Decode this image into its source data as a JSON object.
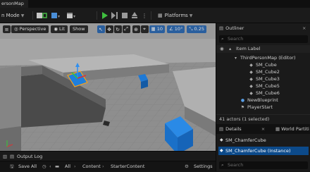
{
  "window": {
    "tab_title": "ersonMap"
  },
  "toolbar": {
    "mode": "n Mode",
    "platforms": "Platforms"
  },
  "viewport": {
    "perspective": "Perspective",
    "lit": "Lit",
    "show": "Show",
    "grid_snap": "10",
    "rot_snap": "10°",
    "scale_snap": "0.25",
    "colors": {
      "selection": "#f0a020",
      "accent_cube": "#1a7bd8"
    }
  },
  "outliner": {
    "title": "Outliner",
    "search_placeholder": "Search",
    "column_label": "Item Label",
    "items": [
      {
        "label": "ThirdPersonMap (Editor)",
        "icon": "level-icon"
      },
      {
        "label": "SM_Cube",
        "icon": "mesh-icon"
      },
      {
        "label": "SM_Cube2",
        "icon": "mesh-icon"
      },
      {
        "label": "SM_Cube3",
        "icon": "mesh-icon"
      },
      {
        "label": "SM_Cube5",
        "icon": "mesh-icon"
      },
      {
        "label": "SM_Cube6",
        "icon": "mesh-icon"
      },
      {
        "label": "NewBlueprint",
        "icon": "blueprint-icon"
      },
      {
        "label": "PlayerStart",
        "icon": "player-start-icon"
      }
    ],
    "footer": "41 actors (1 selected)"
  },
  "details": {
    "tab_details": "Details",
    "tab_world": "World Partiti",
    "actor_name": "SM_ChamferCube",
    "instance": "SM_ChamferCube (Instance)",
    "search_placeholder": "Search"
  },
  "bottom": {
    "output_log": "Output Log",
    "save_all": "Save All",
    "all": "All",
    "content": "Content",
    "starter_content": "StarterContent",
    "settings": "Settings"
  }
}
